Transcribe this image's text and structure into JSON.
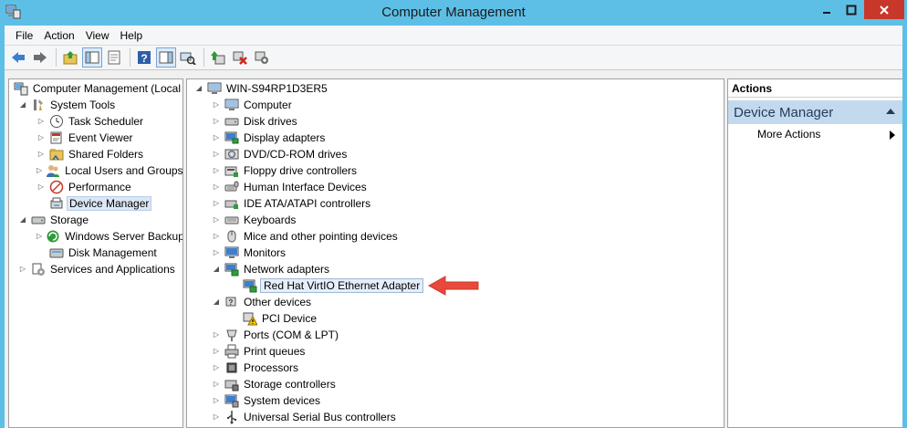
{
  "window": {
    "title": "Computer Management"
  },
  "menu": [
    "File",
    "Action",
    "View",
    "Help"
  ],
  "toolbar": {
    "buttons": [
      "back-icon",
      "forward-icon",
      "up-folder-icon",
      "show-hide-tree-icon",
      "properties-icon",
      "help-icon",
      "show-hide-action-pane-icon",
      "scan-hardware-icon",
      "update-driver-icon",
      "uninstall-icon",
      "disable-device-icon"
    ]
  },
  "left_tree": {
    "root": "Computer Management (Local",
    "system_tools": "System Tools",
    "task_scheduler": "Task Scheduler",
    "event_viewer": "Event Viewer",
    "shared_folders": "Shared Folders",
    "local_users": "Local Users and Groups",
    "performance": "Performance",
    "device_manager": "Device Manager",
    "storage": "Storage",
    "windows_server_backup": "Windows Server Backup",
    "disk_management": "Disk Management",
    "services_apps": "Services and Applications"
  },
  "device_tree": {
    "root": "WIN-S94RP1D3ER5",
    "categories": [
      "Computer",
      "Disk drives",
      "Display adapters",
      "DVD/CD-ROM drives",
      "Floppy drive controllers",
      "Human Interface Devices",
      "IDE ATA/ATAPI controllers",
      "Keyboards",
      "Mice and other pointing devices",
      "Monitors"
    ],
    "network_adapters": "Network adapters",
    "network_child": "Red Hat VirtIO Ethernet Adapter",
    "other_devices": "Other devices",
    "other_child": "PCI Device",
    "categories_after": [
      "Ports (COM & LPT)",
      "Print queues",
      "Processors",
      "Storage controllers",
      "System devices",
      "Universal Serial Bus controllers"
    ]
  },
  "actions": {
    "header": "Actions",
    "section": "Device Manager",
    "more": "More Actions"
  },
  "annotation": {
    "arrow_color": "#e8493a"
  }
}
